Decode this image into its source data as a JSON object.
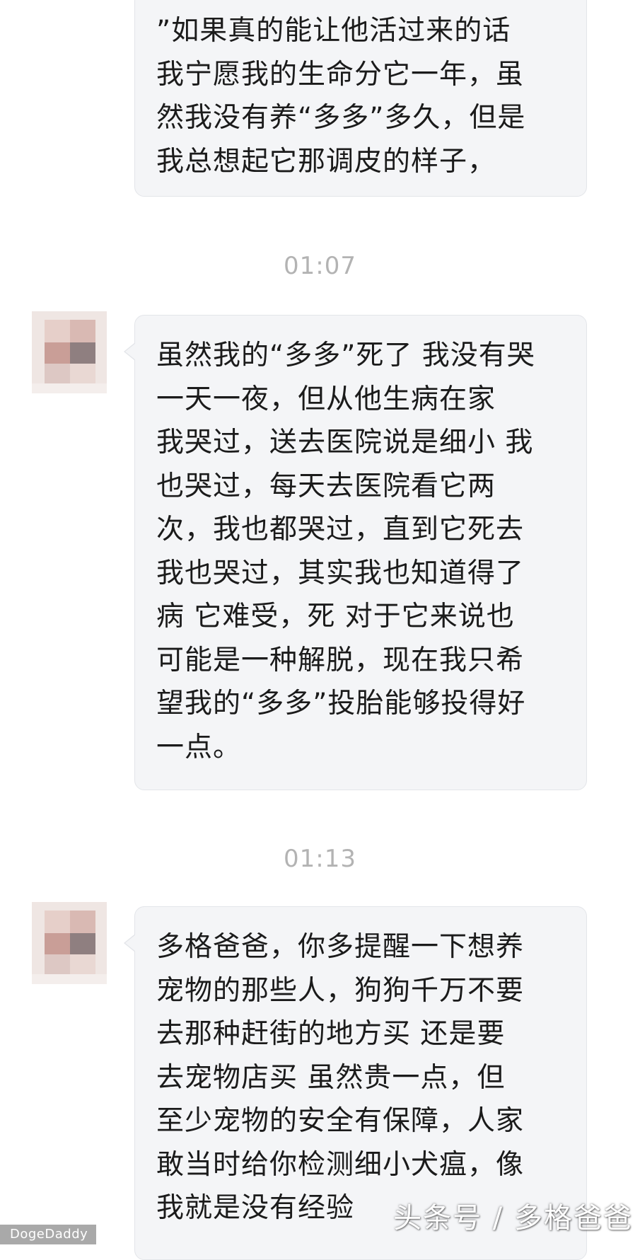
{
  "messages": [
    {
      "sender": "other",
      "text": "”如果真的能让他活过来的话\n我宁愿我的生命分它一年，虽\n然我没有养“多多”多久，但是\n我总想起它那调皮的样子，"
    },
    {
      "timestamp": "01:07",
      "sender": "other",
      "text": "虽然我的“多多”死了 我没有哭\n一天一夜，但从他生病在家\n我哭过，送去医院说是细小 我\n也哭过，每天去医院看它两\n次，我也都哭过，直到它死去\n我也哭过，其实我也知道得了\n病 它难受，死 对于它来说也\n可能是一种解脱，现在我只希\n望我的“多多”投胎能够投得好\n一点。"
    },
    {
      "timestamp": "01:13",
      "sender": "other",
      "text": "多格爸爸，你多提醒一下想养\n宠物的那些人，狗狗千万不要\n去那种赶街的地方买 还是要\n去宠物店买 虽然贵一点，但\n至少宠物的安全有保障，人家\n敢当时给你检测细小犬瘟，像\n我就是没有经验"
    }
  ],
  "watermarks": {
    "left": "DogeDaddy",
    "right": "头条号 / 多格爸爸"
  },
  "colors": {
    "bubble_bg": "#f4f5f7",
    "bubble_border": "#e3e5e9",
    "timestamp": "#b3b3b3",
    "text": "#1b1b1b"
  }
}
